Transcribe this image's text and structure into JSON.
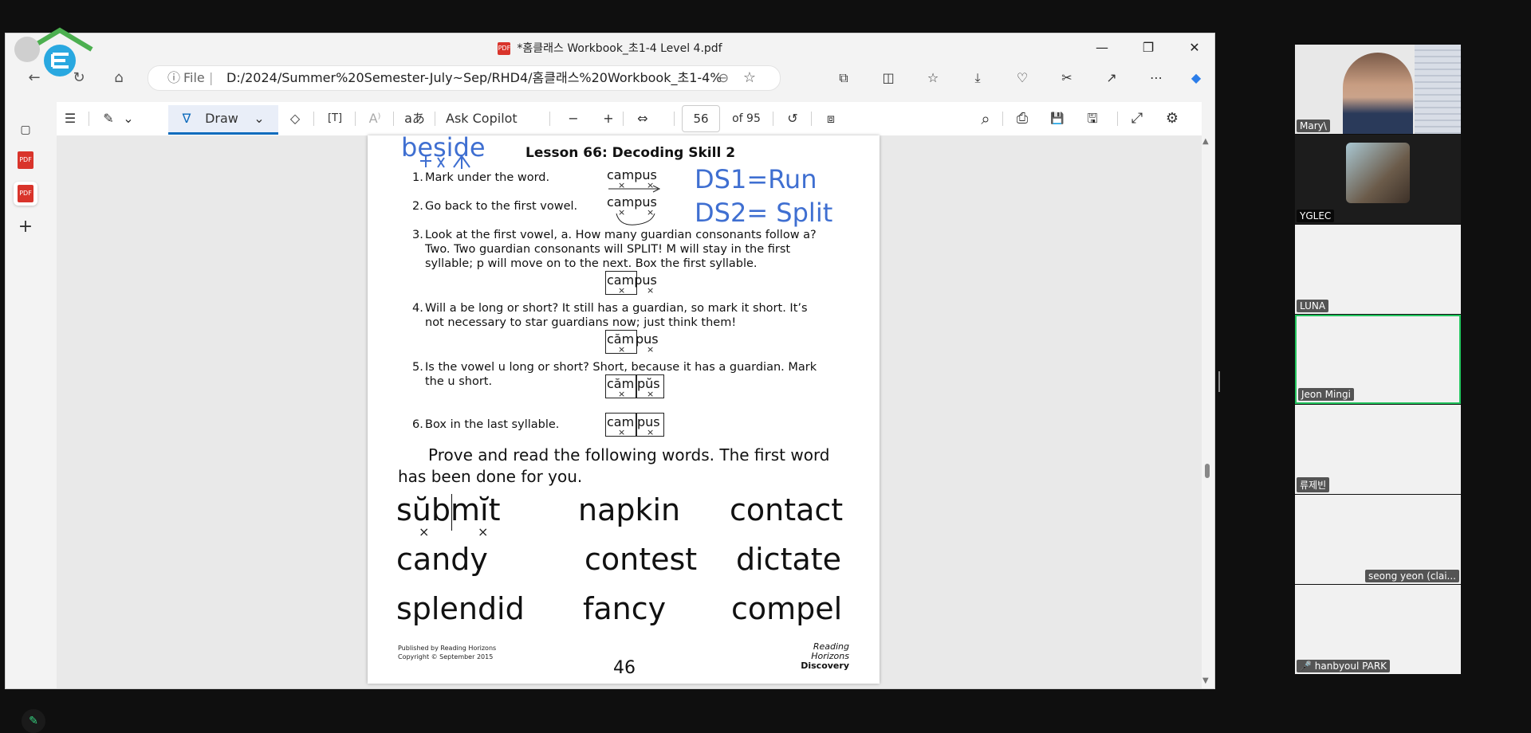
{
  "window": {
    "title": "*홈클래스 Workbook_초1-4 Level 4.pdf",
    "pdf_badge": "PDF",
    "minimize": "—",
    "restore": "❐",
    "close": "✕"
  },
  "address_bar": {
    "back": "←",
    "home": "⌂",
    "refresh": "↻",
    "info": "ⓘ",
    "scheme": "File",
    "separator": "|",
    "url": "D:/2024/Summer%20Semester-July~Sep/RHD4/홈클래스%20Workbook_초1-4%...",
    "zoom_icon": "⊖",
    "star": "☆"
  },
  "browser_toolbar": [
    "⧉",
    "◫",
    "☆",
    "⤓",
    "♡",
    "✂",
    "↗",
    "⋯",
    "◆"
  ],
  "sidebar": {
    "tab_icon": "▢",
    "pdf_label": "PDF",
    "add": "+"
  },
  "pdf_toolbar": {
    "contents": "☰",
    "highlight": "✎",
    "highlight_dd": "⌄",
    "draw_icon": "∇",
    "draw_label": "Draw",
    "draw_dd": "⌄",
    "erase": "◇",
    "textbox": "[T]",
    "read_aloud": "A⁾",
    "translate": "aあ",
    "ask_copilot": "Ask Copilot",
    "zoom_out": "−",
    "zoom_in": "+",
    "fit": "⇔",
    "page_current": "56",
    "page_total": "of 95",
    "rotate": "↺",
    "layout": "⧈",
    "search": "⌕",
    "print": "⎙",
    "save": "💾",
    "save_as": "🖫",
    "fullscreen": "⤢",
    "settings": "⚙"
  },
  "page": {
    "handwriting": {
      "beside": "beside",
      "ds1": "DS1=Run",
      "ds2": "DS2= Split"
    },
    "lesson_title": "Lesson 66: Decoding Skill 2",
    "steps": [
      {
        "num": "1.",
        "text": "Mark under the word."
      },
      {
        "num": "2.",
        "text": "Go back to the first vowel."
      },
      {
        "num": "3.",
        "text": "Look at the first vowel, a. How many guardian consonants follow a? Two. Two guardian consonants will SPLIT! M will stay in the first syllable; p will move on to the next. Box the first syllable."
      },
      {
        "num": "4.",
        "text": "Will a be long or short? It still has a guardian, so mark it short. It’s not necessary to star guardians now; just think them!"
      },
      {
        "num": "5.",
        "text": "Is the vowel u long or short? Short, because it has a guardian. Mark the u short."
      },
      {
        "num": "6.",
        "text": "Box in the last syllable."
      }
    ],
    "example_words": {
      "campus": "campus",
      "cam": "cam",
      "pus": "pus",
      "cam_short": "căm",
      "pus_short": "pŭs",
      "mark_x": "×"
    },
    "prove_text": "Prove and read the following words. The first word has been done for you.",
    "words": [
      [
        "sŭbmĭt",
        "napkin",
        "contact"
      ],
      [
        "candy",
        "contest",
        "dictate"
      ],
      [
        "splendid",
        "fancy",
        "compel"
      ]
    ],
    "published_line1": "Published by Reading Horizons",
    "published_line2": "Copyright © September 2015",
    "page_number": "46",
    "rh_logo_line1": "Reading",
    "rh_logo_line2": "Horizons",
    "rh_logo_line3": "Discovery"
  },
  "scrollbar": {
    "up": "▲",
    "down": "▼"
  },
  "pen_button": "✎",
  "participants": [
    {
      "name": "Mary\\",
      "type": "video"
    },
    {
      "name": "YGLEC",
      "type": "photo"
    },
    {
      "name": "LUNA",
      "type": "blank"
    },
    {
      "name": "Jeon Mingi",
      "type": "blank"
    },
    {
      "name": "류제빈",
      "type": "blank"
    },
    {
      "name": "seong yeon (clai...",
      "type": "blank"
    },
    {
      "name": "hanbyoul PARK",
      "type": "blank"
    }
  ],
  "colors": {
    "handwriting_blue": "#3f6fd1",
    "active_speaker": "#22c55e",
    "edge_accent": "#0f6cbd"
  }
}
